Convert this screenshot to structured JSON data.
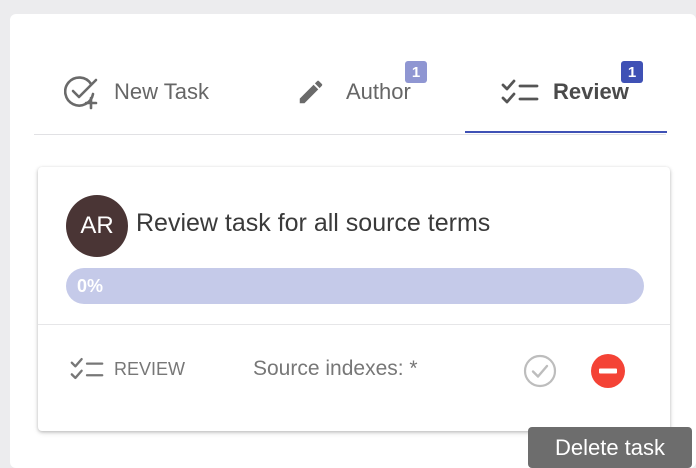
{
  "tabs": {
    "new_task": {
      "label": "New Task",
      "icon": "add-task-icon"
    },
    "author": {
      "label": "Author",
      "badge": "1",
      "icon": "pencil-icon"
    },
    "review": {
      "label": "Review",
      "badge": "1",
      "icon": "checklist-icon",
      "active": true
    }
  },
  "task": {
    "avatar_initials": "AR",
    "title": "Review task for all source terms",
    "progress_label": "0%",
    "progress_value": 0,
    "type_label": "REVIEW",
    "type_icon": "checklist-icon",
    "source_indexes": "Source indexes: *",
    "approve_icon": "check-circle-icon",
    "delete_icon": "remove-circle-icon"
  },
  "tooltip": {
    "text": "Delete task"
  },
  "colors": {
    "accent": "#3f51b5",
    "progress_track": "#c5cae9",
    "delete": "#f44336",
    "avatar": "#4a3535"
  }
}
